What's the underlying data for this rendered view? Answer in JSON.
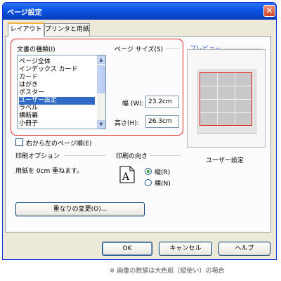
{
  "window": {
    "title": "ページ設定",
    "close_label": "✕"
  },
  "tabs": [
    {
      "label": "レイアウト",
      "active": true
    },
    {
      "label": "プリンタと用紙",
      "active": false
    }
  ],
  "doc_type": {
    "label": "文書の種類(I)",
    "items": [
      "ページ全体",
      "インデックス カード",
      "カード",
      "はがき",
      "ポスター",
      "ユーザー設定",
      "ラベル",
      "横断幕",
      "小冊子"
    ],
    "selected": "ユーザー設定"
  },
  "page_size": {
    "label": "ページ サイズ(S)",
    "width_label": "幅 (W):",
    "width_value": "23.2cm",
    "height_label": "高さ(H):",
    "height_value": "26.3cm"
  },
  "right_to_left": {
    "label": "右から左のページ順(E)",
    "checked": false
  },
  "print_options": {
    "label": "印刷オプション",
    "text": "用紙を 0cm 重ねます。"
  },
  "orientation": {
    "label": "印刷の向き",
    "portrait_label": "縦(R)",
    "landscape_label": "横(N)",
    "selected": "portrait",
    "glyph": "A"
  },
  "overlap_button": "重なりの変更(O)...",
  "preview": {
    "label": "プレビュー",
    "caption": "ユーザー設定"
  },
  "buttons": {
    "ok": "OK",
    "cancel": "キャンセル",
    "help": "ヘルプ"
  },
  "footnote": "※ 画像の数値は大色紙（縦使い）の場合",
  "colors": {
    "highlight_border": "#e2231a",
    "selection": "#316ac5",
    "titlebar": "#0a55e6"
  }
}
